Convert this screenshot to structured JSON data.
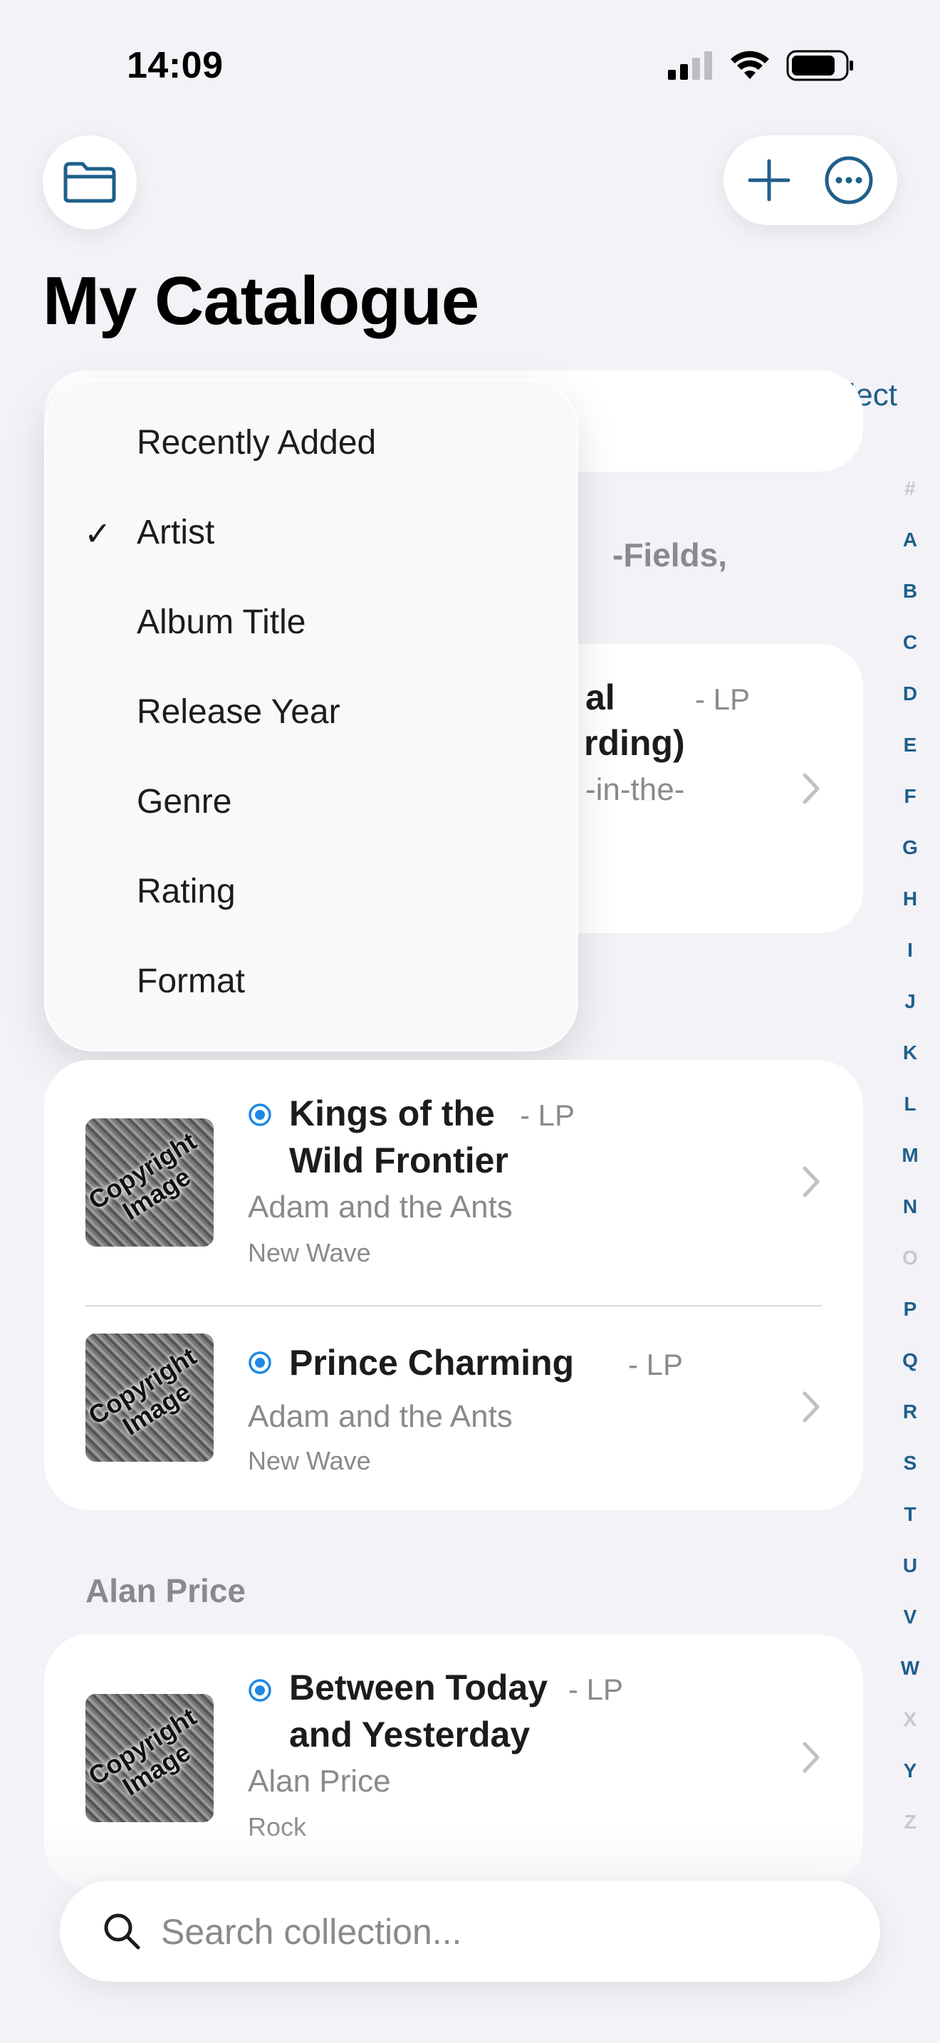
{
  "status": {
    "time": "14:09"
  },
  "header": {
    "title": "My Catalogue",
    "select_label": "Select"
  },
  "background": {
    "fragment_fields": "-Fields,",
    "fragment_title_1": "al",
    "fragment_title_2": "rding)",
    "fragment_format": "- LP",
    "fragment_artist": "-in-the-"
  },
  "sort_menu": {
    "items": [
      {
        "label": "Recently Added",
        "checked": false
      },
      {
        "label": "Artist",
        "checked": true
      },
      {
        "label": "Album Title",
        "checked": false
      },
      {
        "label": "Release Year",
        "checked": false
      },
      {
        "label": "Genre",
        "checked": false
      },
      {
        "label": "Rating",
        "checked": false
      },
      {
        "label": "Format",
        "checked": false
      }
    ],
    "check_glyph": "✓"
  },
  "sections": [
    {
      "albums": [
        {
          "title_line1": "Kings of the",
          "title_line2": "Wild Frontier",
          "format": "- LP",
          "artist": "Adam and the Ants",
          "genre": "New Wave",
          "thumb_line1": "Copyright",
          "thumb_line2": "Image"
        },
        {
          "title_line1": "Prince Charming",
          "title_line2": "",
          "format": "- LP",
          "artist": "Adam and the Ants",
          "genre": "New Wave",
          "thumb_line1": "Copyright",
          "thumb_line2": "Image"
        }
      ]
    },
    {
      "heading": "Alan Price",
      "albums": [
        {
          "title_line1": "Between Today",
          "title_line2": "and Yesterday",
          "format": "- LP",
          "artist": "Alan Price",
          "genre": "Rock",
          "thumb_line1": "Copyright",
          "thumb_line2": "Image"
        }
      ]
    }
  ],
  "index": [
    "#",
    "A",
    "B",
    "C",
    "D",
    "E",
    "F",
    "G",
    "H",
    "I",
    "J",
    "K",
    "L",
    "M",
    "N",
    "O",
    "P",
    "Q",
    "R",
    "S",
    "T",
    "U",
    "V",
    "W",
    "X",
    "Y",
    "Z"
  ],
  "index_disabled": [
    "#",
    "O",
    "X",
    "Z"
  ],
  "search": {
    "placeholder": "Search collection..."
  },
  "icons": {
    "folder": "folder-icon",
    "add": "plus-icon",
    "more": "ellipsis-circle-icon",
    "search": "magnifier-icon",
    "radio": "radio-selected-icon",
    "chevron": "chevron-right-icon"
  },
  "colors": {
    "accent": "#1f5f8b",
    "radio": "#1e88e5",
    "background": "#f2f2f7"
  }
}
